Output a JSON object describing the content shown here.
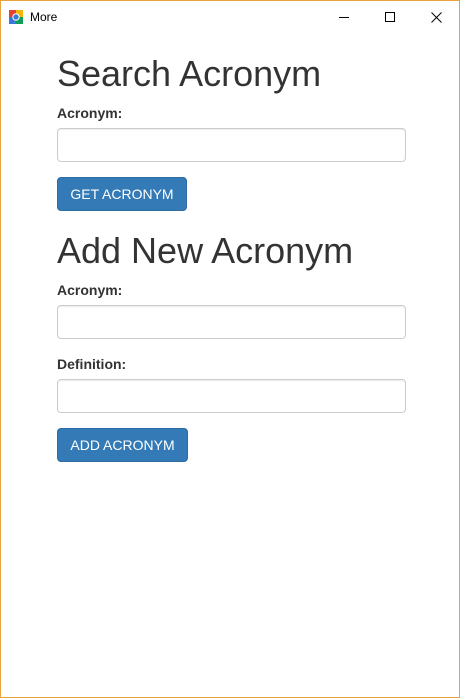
{
  "window": {
    "title": "More"
  },
  "search_section": {
    "heading": "Search Acronym",
    "acronym_label": "Acronym:",
    "acronym_value": "",
    "submit_label": "GET ACRONYM"
  },
  "add_section": {
    "heading": "Add New Acronym",
    "acronym_label": "Acronym:",
    "acronym_value": "",
    "definition_label": "Definition:",
    "definition_value": "",
    "submit_label": "ADD ACRONYM"
  },
  "colors": {
    "button_primary": "#337ab7",
    "window_border": "#e8a33c",
    "heading_text": "#333333"
  }
}
